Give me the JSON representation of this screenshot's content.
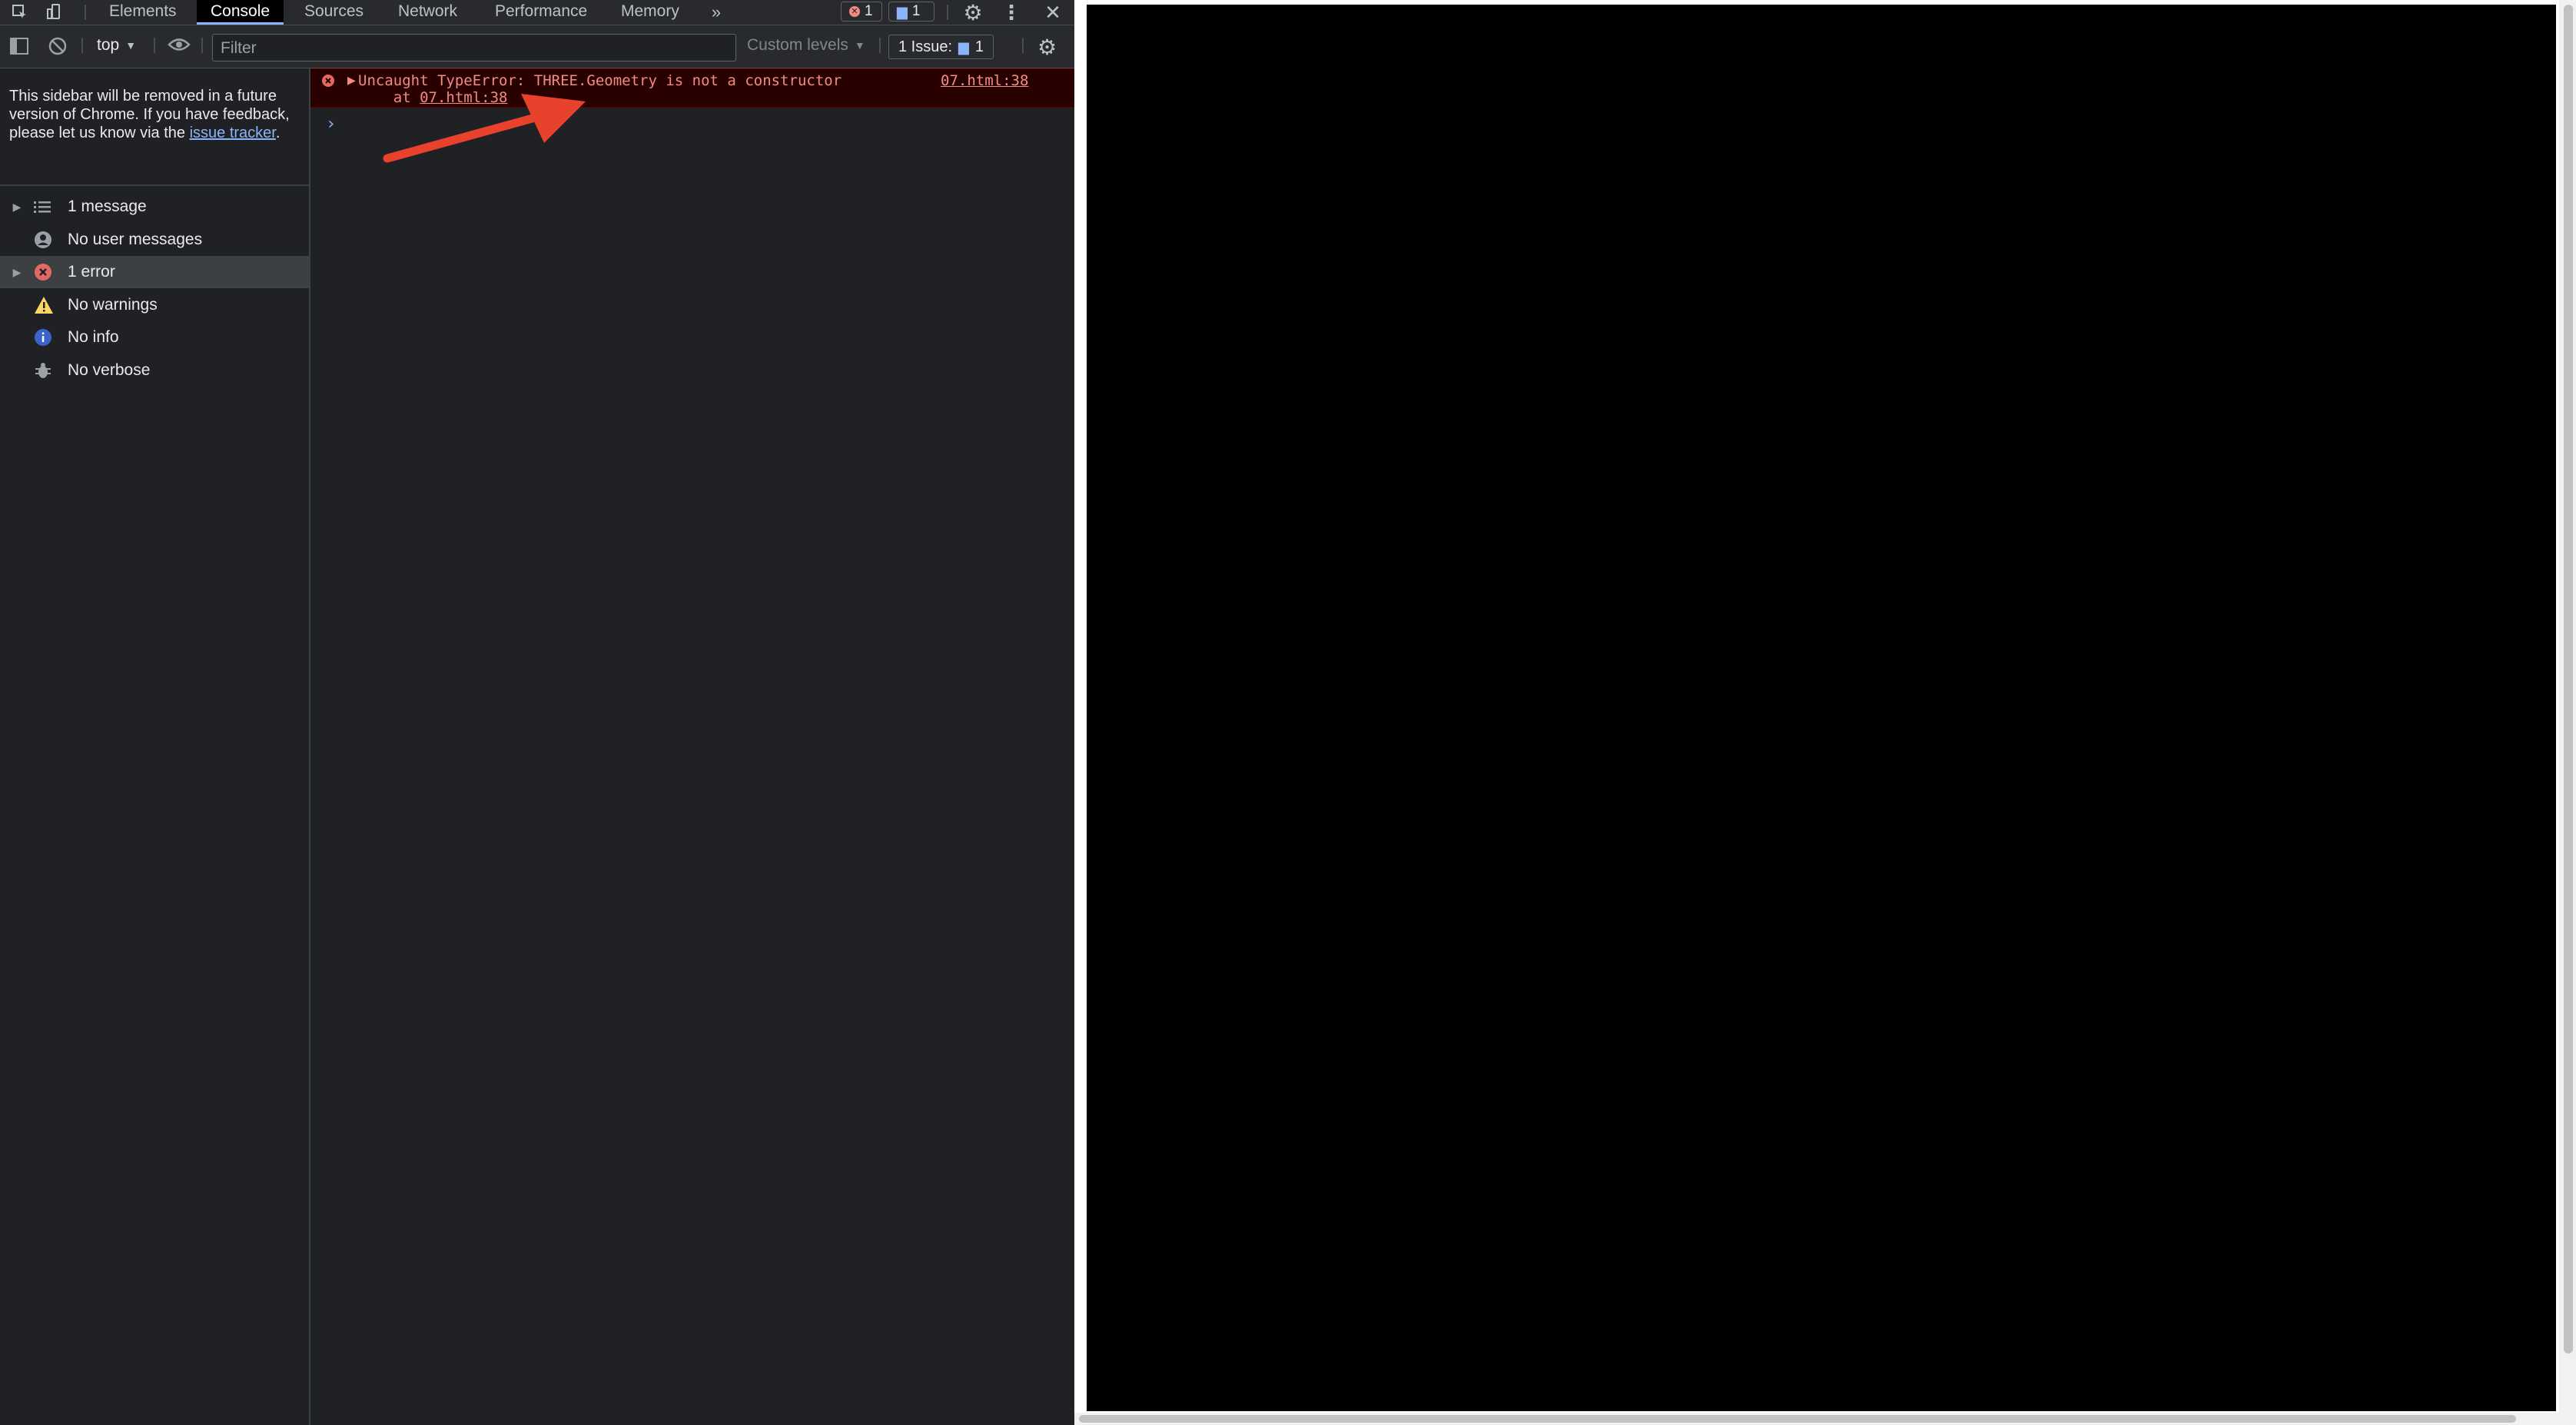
{
  "tabs": [
    "Elements",
    "Console",
    "Sources",
    "Network",
    "Performance",
    "Memory"
  ],
  "active_tab": "Console",
  "more_tabs_icon": "double-chevron-right-icon",
  "error_counter": "1",
  "message_counter": "1",
  "toolbar": {
    "context": "top",
    "filter_placeholder": "Filter",
    "levels": "Custom levels",
    "issues_label": "1 Issue:",
    "issues_count": "1"
  },
  "sidebar": {
    "notice_text": "This sidebar will be removed in a future version of Chrome. If you have feedback, please let us know via the ",
    "notice_link": "issue tracker",
    "notice_end": ".",
    "items": [
      {
        "label": "1 message",
        "icon": "list-icon"
      },
      {
        "label": "No user messages",
        "icon": "user-icon"
      },
      {
        "label": "1 error",
        "icon": "error-icon"
      },
      {
        "label": "No warnings",
        "icon": "warning-icon"
      },
      {
        "label": "No info",
        "icon": "info-icon"
      },
      {
        "label": "No verbose",
        "icon": "bug-icon"
      }
    ]
  },
  "console": {
    "error_message": "Uncaught TypeError: THREE.Geometry is not a constructor",
    "error_at": "    at ",
    "error_location": "07.html:38",
    "error_source": "07.html:38",
    "prompt": "›"
  },
  "colors": {
    "accent": "#8ab4f8",
    "error": "#f28b82",
    "error_bg": "#290000",
    "annotation_arrow": "#e8412c"
  }
}
